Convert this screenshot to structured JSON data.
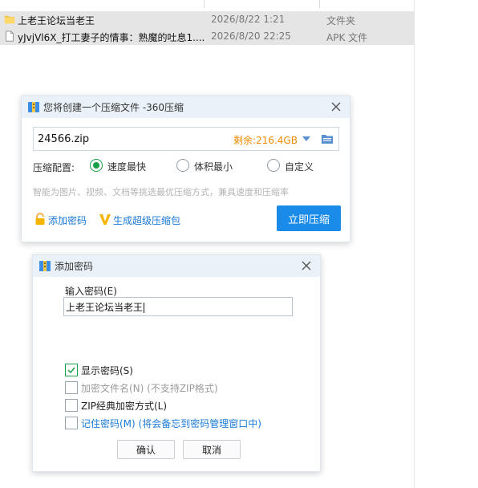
{
  "explorer": {
    "files": [
      {
        "name": "上老王论坛当老王",
        "date": "2026/8/22 1:21",
        "type": "文件夹",
        "icon": "folder-icon"
      },
      {
        "name": "yJvjVl6X_打工妻子的情事：熟魔的吐息1....",
        "date": "2026/8/20 22:25",
        "type": "APK 文件",
        "icon": "file-icon"
      }
    ]
  },
  "compress_dialog": {
    "title": "您将创建一个压缩文件 -360压缩",
    "filename": "24566.zip",
    "remaining": "剩余:216.4GB",
    "config_label": "压缩配置:",
    "options": [
      {
        "label": "速度最快",
        "selected": true
      },
      {
        "label": "体积最小",
        "selected": false
      },
      {
        "label": "自定义",
        "selected": false
      }
    ],
    "hint": "智能为图片、视频、文档等挑选最优压缩方式，兼具速度和压缩率",
    "add_password_label": "添加密码",
    "super_compress_label": "生成超级压缩包",
    "compress_button_label": "立即压缩",
    "accent_color": "#1a8be8",
    "remaining_color": "#f08a00"
  },
  "password_dialog": {
    "title": "添加密码",
    "input_label": "输入密码(E)",
    "password_value": "上老王论坛当老王",
    "checkboxes": [
      {
        "label": "显示密码(S)",
        "checked": true,
        "disabled": false
      },
      {
        "label": "加密文件名(N) (不支持ZIP格式)",
        "checked": false,
        "disabled": true
      },
      {
        "label": "ZIP经典加密方式(L)",
        "checked": false,
        "disabled": false
      },
      {
        "label": "记住密码(M) (将会备忘到密码管理窗口中)",
        "checked": false,
        "disabled": false
      }
    ],
    "ok_label": "确认",
    "cancel_label": "取消"
  }
}
